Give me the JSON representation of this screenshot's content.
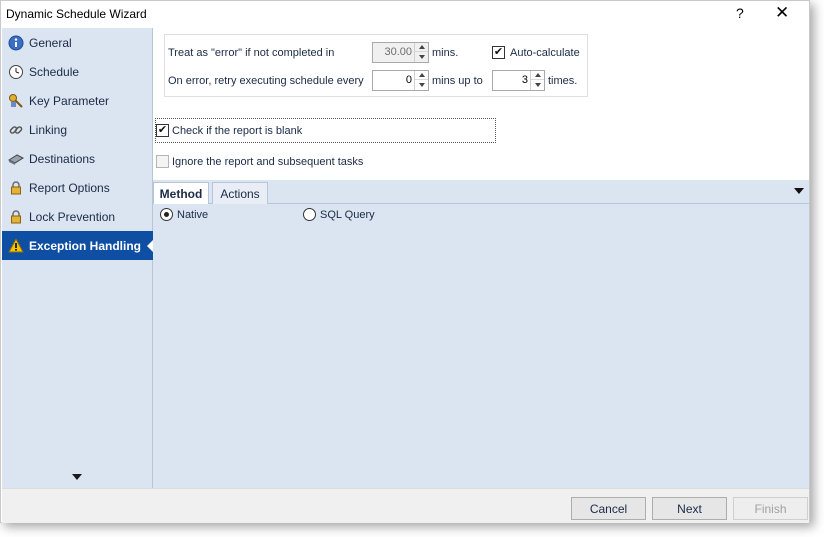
{
  "window": {
    "title": "Dynamic Schedule Wizard",
    "help_label": "?",
    "close_label": "✕"
  },
  "sidebar": {
    "items": [
      {
        "label": "General",
        "icon": "info-icon"
      },
      {
        "label": "Schedule",
        "icon": "clock-icon"
      },
      {
        "label": "Key Parameter",
        "icon": "key-icon"
      },
      {
        "label": "Linking",
        "icon": "link-icon"
      },
      {
        "label": "Destinations",
        "icon": "destinations-icon"
      },
      {
        "label": "Report Options",
        "icon": "lock-icon"
      },
      {
        "label": "Lock Prevention",
        "icon": "lock-icon"
      },
      {
        "label": "Exception Handling",
        "icon": "warning-icon",
        "active": true
      }
    ]
  },
  "error_settings": {
    "treat_label": "Treat as \"error\" if not completed in",
    "timeout_value": "30.00",
    "timeout_unit": "mins.",
    "auto_calculate_label": "Auto-calculate",
    "auto_calculate_checked": true,
    "retry_label": "On error, retry  executing schedule every",
    "retry_interval_value": "0",
    "retry_interval_unit": "mins up to",
    "retry_count_value": "3",
    "retry_count_unit": "times."
  },
  "options": {
    "check_blank_label": "Check if the report is blank",
    "check_blank_checked": true,
    "ignore_label": "Ignore the report and subsequent tasks",
    "ignore_checked": false
  },
  "tabs": [
    {
      "label": "Method",
      "active": true
    },
    {
      "label": "Actions",
      "active": false
    }
  ],
  "method": {
    "native_label": "Native",
    "sql_label": "SQL Query",
    "selected": "Native"
  },
  "footer": {
    "cancel_label": "Cancel",
    "next_label": "Next",
    "finish_label": "Finish"
  },
  "colors": {
    "sidebar_bg": "#dbe4f1",
    "active_item_bg": "#0e4ea3",
    "warning_yellow": "#f5c400"
  }
}
